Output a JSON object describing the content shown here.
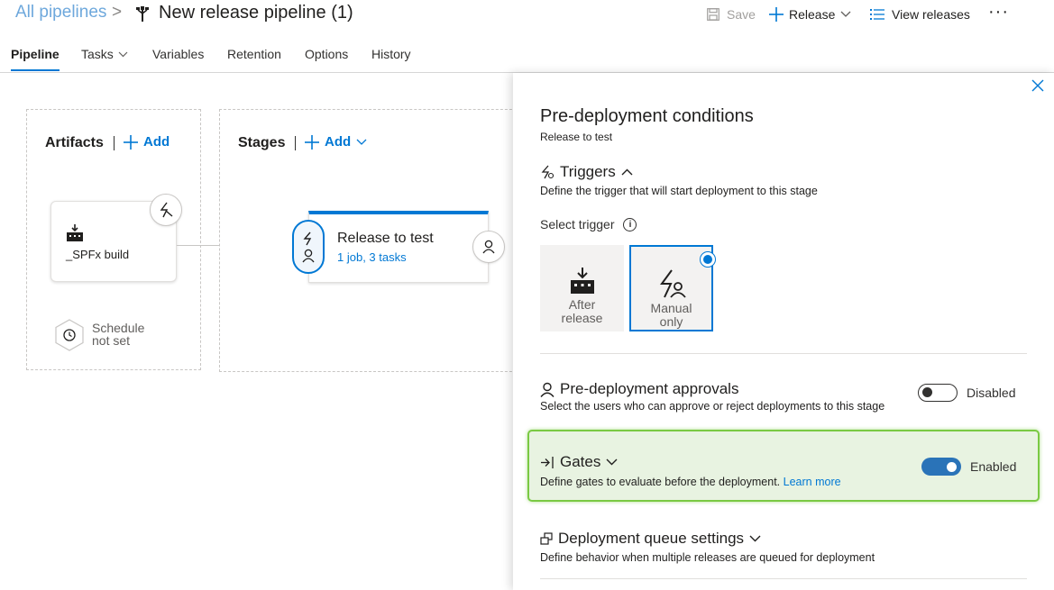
{
  "header": {
    "breadcrumb_link": "All pipelines",
    "breadcrumb_sep": ">",
    "pipeline_title": "New release pipeline (1)",
    "save_label": "Save",
    "release_label": "Release",
    "view_releases_label": "View releases",
    "more_label": "···"
  },
  "tabs": [
    {
      "label": "Pipeline",
      "active": true
    },
    {
      "label": "Tasks",
      "has_dropdown": true
    },
    {
      "label": "Variables"
    },
    {
      "label": "Retention"
    },
    {
      "label": "Options"
    },
    {
      "label": "History"
    }
  ],
  "canvas": {
    "artifacts": {
      "title": "Artifacts",
      "add_label": "Add",
      "artifact_name": "_SPFx build",
      "schedule_line1": "Schedule",
      "schedule_line2": "not set"
    },
    "stages": {
      "title": "Stages",
      "add_label": "Add",
      "stage_name": "Release to test",
      "stage_summary": "1 job, 3 tasks"
    }
  },
  "panel": {
    "title": "Pre-deployment conditions",
    "subtitle": "Release to test",
    "triggers": {
      "title": "Triggers",
      "description": "Define the trigger that will start deployment to this stage",
      "select_label": "Select trigger",
      "info_glyph": "i",
      "options": [
        {
          "line1": "After",
          "line2": "release",
          "selected": false
        },
        {
          "line1": "Manual",
          "line2": "only",
          "selected": true
        }
      ]
    },
    "approvals": {
      "title": "Pre-deployment approvals",
      "description": "Select the users who can approve or reject deployments to this stage",
      "state_label": "Disabled",
      "enabled": false
    },
    "gates": {
      "title": "Gates",
      "description": "Define gates to evaluate before the deployment.",
      "learn_more": "Learn more",
      "state_label": "Enabled",
      "enabled": true,
      "highlight_color": "#7ac943"
    },
    "queue": {
      "title": "Deployment queue settings",
      "description": "Define behavior when multiple releases are queued for deployment"
    }
  },
  "colors": {
    "accent": "#0078d4",
    "breadcrumb": "#6ea8dc",
    "gates_background": "#e8f3e1"
  }
}
